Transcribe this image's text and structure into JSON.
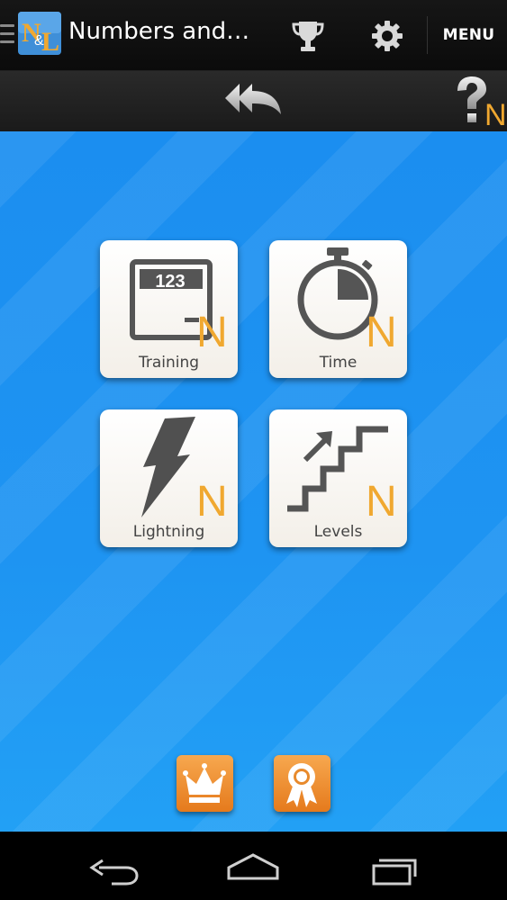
{
  "app": {
    "title": "Numbers and…",
    "menu_label": "MENU",
    "logo_icon": "numbers-and-letters-logo-icon",
    "accent_color": "#f0a830",
    "background_color": "#1e90f0"
  },
  "actionbar": {
    "icons": [
      "hamburger-icon",
      "trophy-icon",
      "gear-icon"
    ]
  },
  "toolbar": {
    "icons": [
      "double-back-arrow-icon",
      "help-question-icon"
    ],
    "help_letter": "N"
  },
  "modes": [
    {
      "label": "Training",
      "icon": "calculator-123-icon",
      "badge": "N"
    },
    {
      "label": "Time",
      "icon": "stopwatch-icon",
      "badge": "N"
    },
    {
      "label": "Lightning",
      "icon": "lightning-bolt-icon",
      "badge": "N"
    },
    {
      "label": "Levels",
      "icon": "stairs-icon",
      "badge": "N"
    }
  ],
  "tile_texts": {
    "training_display": "123"
  },
  "bottom_buttons": [
    {
      "icon": "crown-icon"
    },
    {
      "icon": "award-ribbon-icon"
    }
  ],
  "navbar": {
    "icons": [
      "back-icon",
      "home-icon",
      "recent-apps-icon"
    ]
  }
}
